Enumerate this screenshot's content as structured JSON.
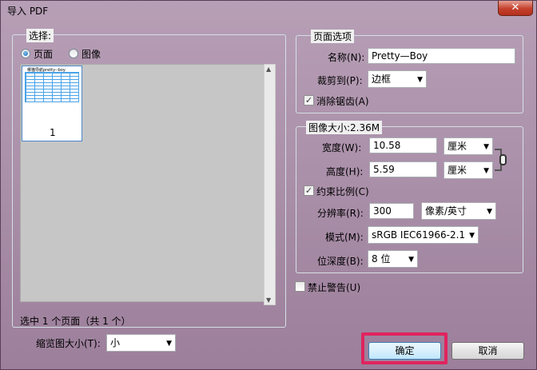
{
  "window": {
    "title": "导入 PDF",
    "close_glyph": "✕"
  },
  "select": {
    "legend": "选择:",
    "radio_page": "页面",
    "radio_image": "图像",
    "thumb_header": "哪猫导航pretty--boy",
    "thumb_number": "1",
    "status": "选中 1 个页面（共 1 个）",
    "thumb_size_label": "缩览图大小(T):",
    "thumb_size_value": "小"
  },
  "page_options": {
    "legend": "页面选项",
    "name_label": "名称(N):",
    "name_value": "Pretty—Boy",
    "crop_label": "裁剪到(P):",
    "crop_value": "边框",
    "antialias_label": "消除锯齿(A)",
    "antialias_checked": true
  },
  "image_size": {
    "legend": "图像大小:2.36M",
    "width_label": "宽度(W):",
    "width_value": "10.58",
    "width_unit": "厘米",
    "height_label": "高度(H):",
    "height_value": "5.59",
    "height_unit": "厘米",
    "constrain_label": "约束比例(C)",
    "constrain_checked": true,
    "resolution_label": "分辨率(R):",
    "resolution_value": "300",
    "resolution_unit": "像素/英寸",
    "mode_label": "模式(M):",
    "mode_value": "sRGB IEC61966-2.1",
    "depth_label": "位深度(B):",
    "depth_value": "8 位"
  },
  "suppress_warnings": {
    "label": "禁止警告(U)",
    "checked": false
  },
  "buttons": {
    "ok": "确定",
    "cancel": "取消"
  },
  "colors": {
    "highlight": "#e0245e",
    "default_button_border": "#3c7fb1"
  }
}
